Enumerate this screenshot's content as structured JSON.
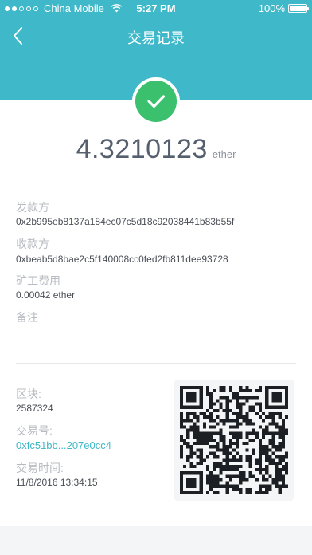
{
  "status_bar": {
    "carrier": "China Mobile",
    "time": "5:27 PM",
    "battery": "100%"
  },
  "nav": {
    "title": "交易记录",
    "back_icon": "chevron-left-icon"
  },
  "transaction": {
    "status_icon": "checkmark-icon",
    "amount": "4.3210123",
    "unit": "ether",
    "sender_label": "发款方",
    "sender": "0x2b995eb8137a184ec07c5d18c92038441b83b55f",
    "receiver_label": "收款方",
    "receiver": "0xbeab5d8bae2c5f140008cc0fed2fb811dee93728",
    "fee_label": "矿工费用",
    "fee": "0.00042 ether",
    "note_label": "备注",
    "block_label": "区块:",
    "block": "2587324",
    "txid_label": "交易号:",
    "txid": "0xfc51bb...207e0cc4",
    "time_label": "交易时间:",
    "time": "11/8/2016 13:34:15"
  },
  "qr_code": {
    "icon": "qr-code-icon"
  },
  "colors": {
    "header": "#3fb8c9",
    "success": "#3bc06e",
    "link": "#3fb8c9"
  }
}
